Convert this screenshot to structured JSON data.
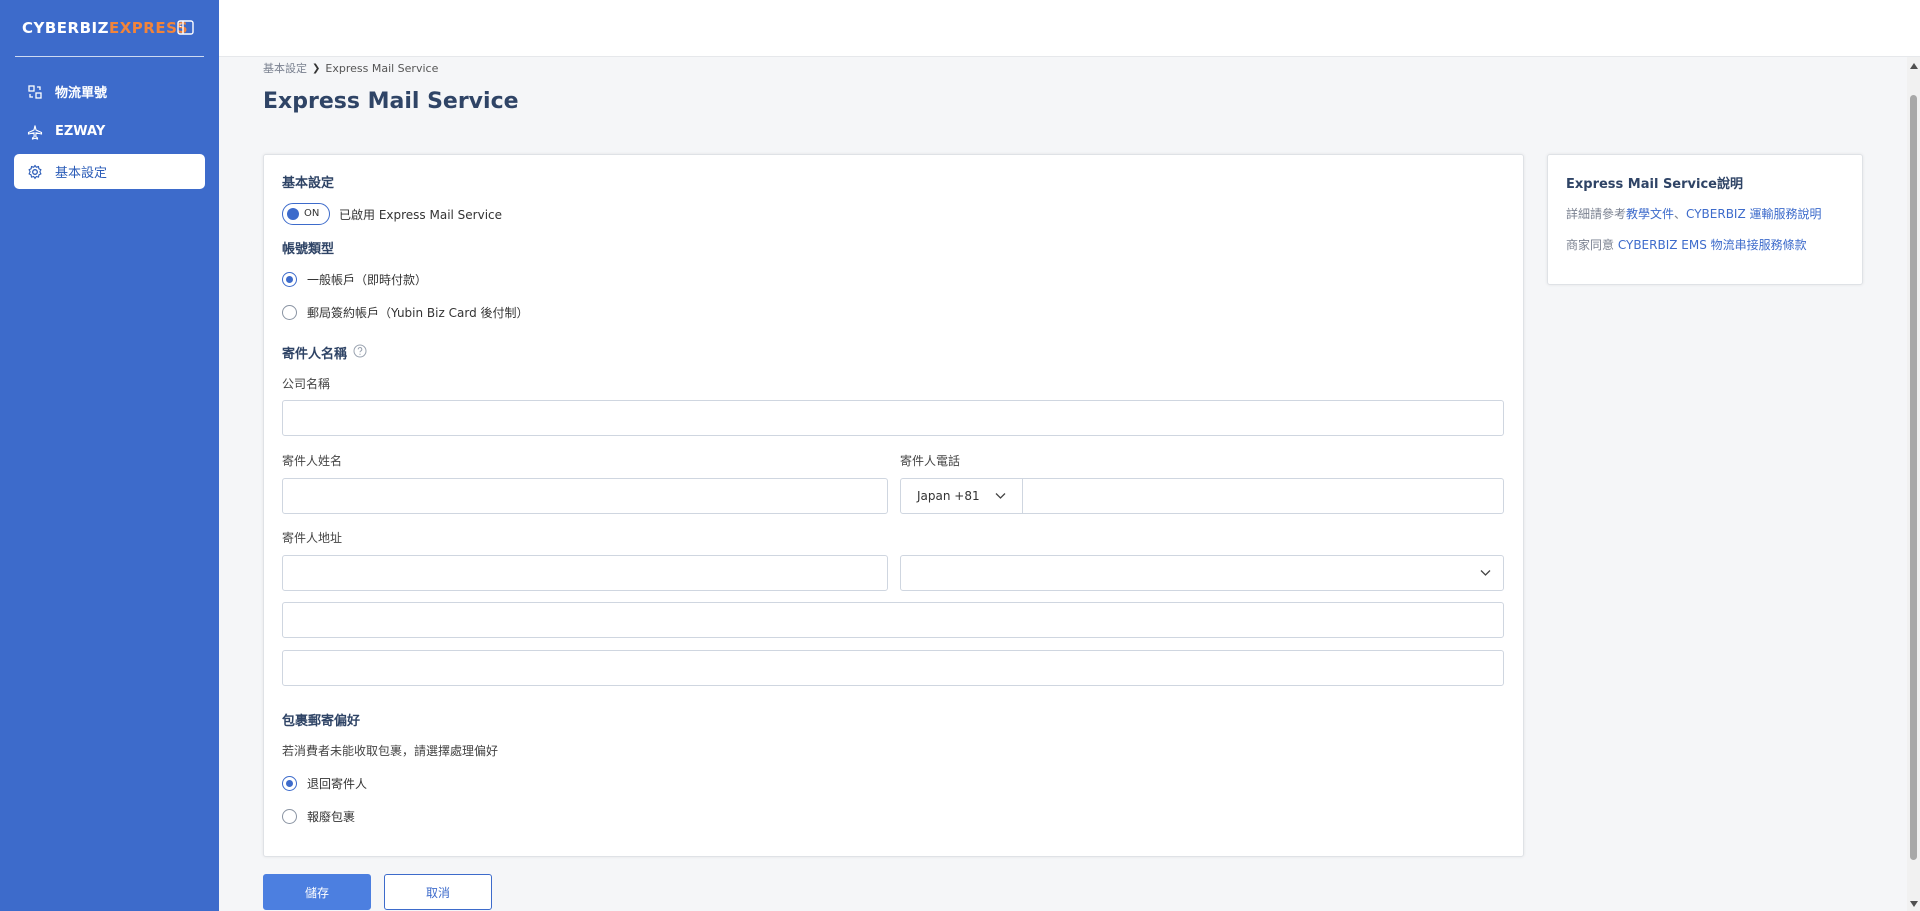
{
  "sidebar": {
    "logo_part1": "CYBERBIZ",
    "logo_part2": "EXPRESS",
    "items": [
      {
        "label": "物流單號",
        "icon": "package-swap-icon"
      },
      {
        "label": "EZWAY",
        "icon": "airplane-icon"
      },
      {
        "label": "基本設定",
        "icon": "gear-icon",
        "active": true
      }
    ]
  },
  "breadcrumb": {
    "parent": "基本設定",
    "current": "Express Mail Service"
  },
  "page": {
    "title": "Express Mail Service"
  },
  "form": {
    "basic_settings_title": "基本設定",
    "toggle_label": "ON",
    "toggle_text": "已啟用 Express Mail Service",
    "account_type_title": "帳號類型",
    "account_options": [
      {
        "label": "一般帳戶（即時付款）",
        "checked": true
      },
      {
        "label": "郵局簽約帳戶（Yubin Biz Card 後付制）",
        "checked": false
      }
    ],
    "sender_name_title": "寄件人名稱",
    "company_label": "公司名稱",
    "company_value": "",
    "sender_name_label": "寄件人姓名",
    "sender_name_value": "",
    "sender_phone_label": "寄件人電話",
    "phone_country": "Japan +81",
    "phone_value": "",
    "sender_address_label": "寄件人地址",
    "address_line1": "",
    "address_select": "",
    "address_line2": "",
    "address_line3": "",
    "parcel_pref_title": "包裹郵寄偏好",
    "parcel_pref_desc": "若消費者未能收取包裹，請選擇處理偏好",
    "parcel_options": [
      {
        "label": "退回寄件人",
        "checked": true
      },
      {
        "label": "報廢包裹",
        "checked": false
      }
    ]
  },
  "actions": {
    "save": "儲存",
    "cancel": "取消"
  },
  "info": {
    "title": "Express Mail Service說明",
    "line1_prefix": "詳細請參考",
    "line1_link1": "教學文件",
    "line1_sep": "、",
    "line1_link2": "CYBERBIZ 運輸服務說明",
    "line2_prefix": "商家同意 ",
    "line2_link": "CYBERBIZ EMS 物流串接服務條款"
  },
  "colors": {
    "sidebar": "#3d6bcb",
    "accent": "#4c7fe0",
    "logo_orange": "#f2843a",
    "title": "#2f4466"
  }
}
